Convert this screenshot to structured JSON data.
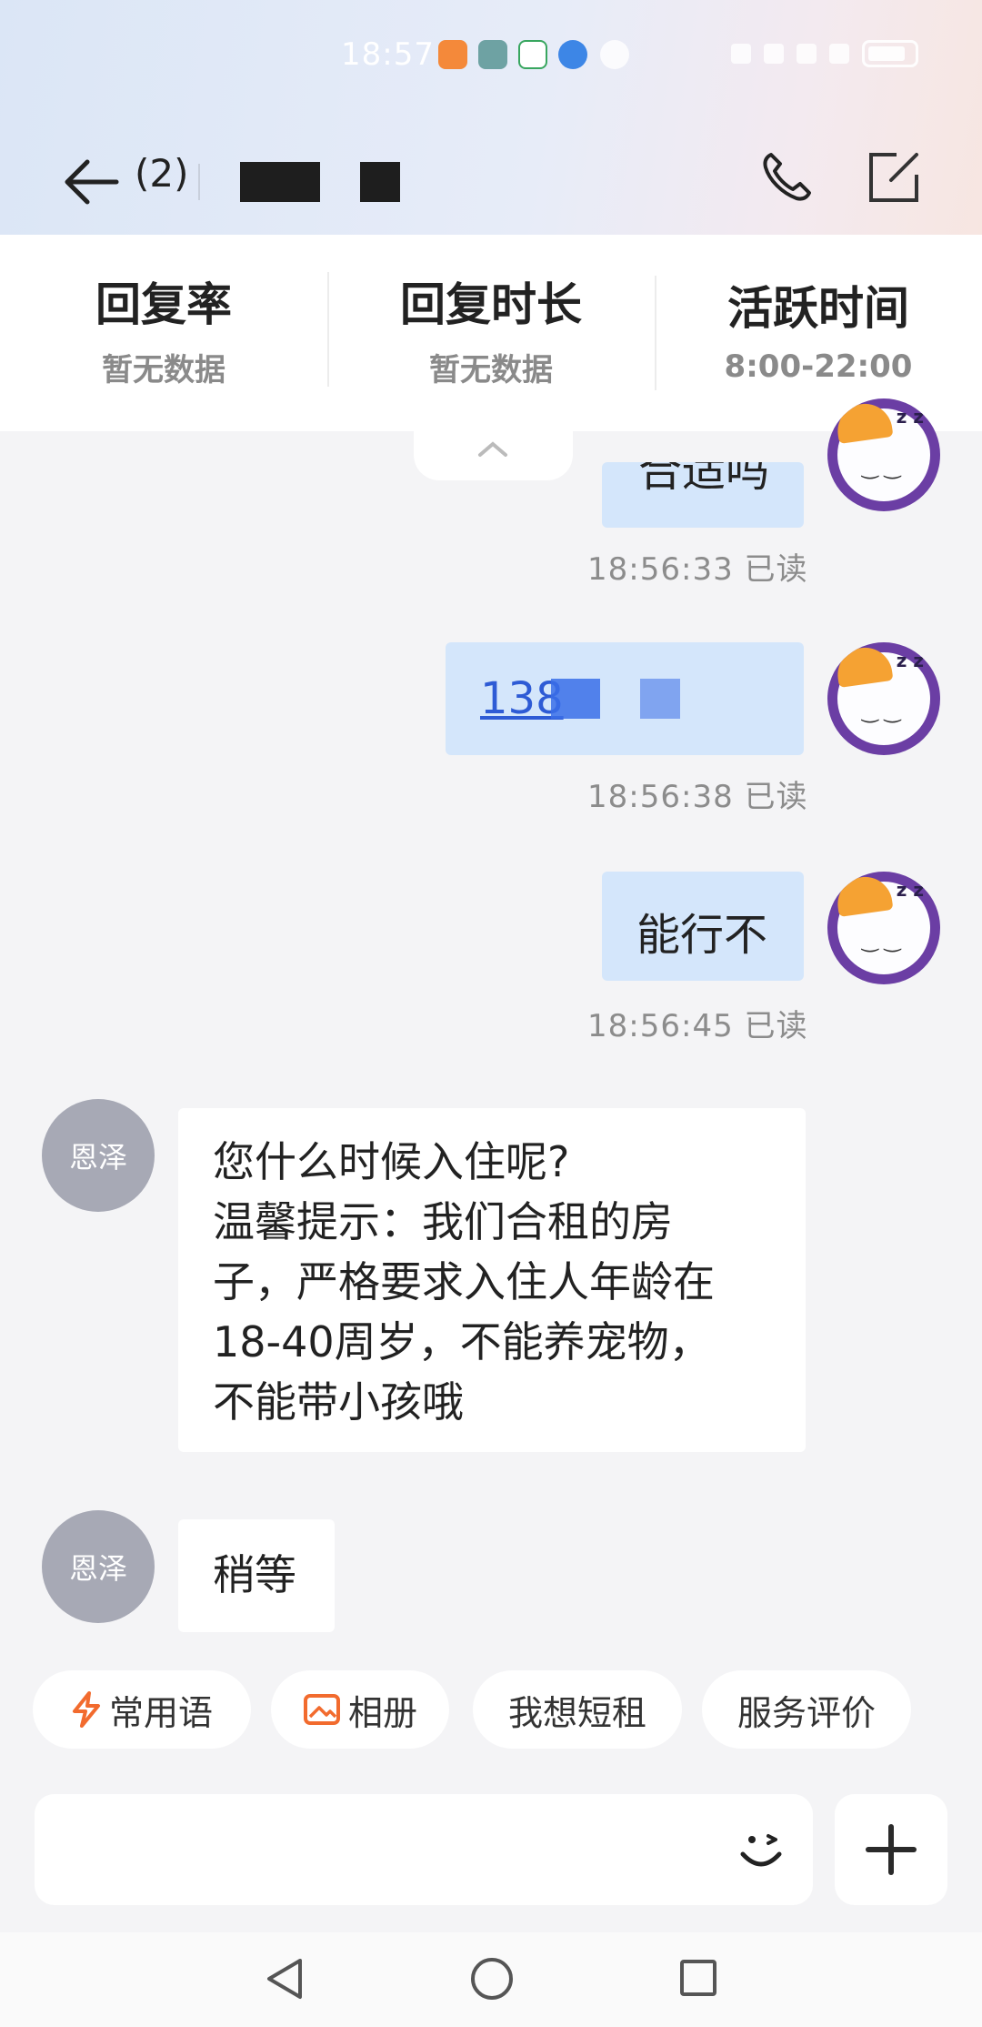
{
  "status_bar": {
    "time": "18:57"
  },
  "header": {
    "back_count": "(2)"
  },
  "stats": [
    {
      "label": "回复率",
      "value": "暂无数据"
    },
    {
      "label": "回复时长",
      "value": "暂无数据"
    },
    {
      "label": "活跃时间",
      "value": "8:00-22:00"
    }
  ],
  "messages": {
    "msg1": {
      "text": "合适吗",
      "time": "18:56:33 已读"
    },
    "msg2": {
      "text": "138",
      "time": "18:56:38 已读"
    },
    "msg3": {
      "text": "能行不",
      "time": "18:56:45 已读"
    },
    "msg4": {
      "sender": "恩泽",
      "lines": [
        "您什么时候入住呢?",
        "温馨提示：我们合租的房",
        "子，严格要求入住人年龄在",
        "18-40周岁，不能养宠物，",
        "不能带小孩哦"
      ]
    },
    "msg5": {
      "sender": "恩泽",
      "text": "稍等"
    }
  },
  "quick_replies": [
    "常用语",
    "相册",
    "我想短租",
    "服务评价"
  ],
  "colors": {
    "accent_orange": "#f26b2e",
    "bubble_out": "#d4e6fb",
    "link": "#2e5bd5",
    "avatar_me_ring": "#6b3ea4"
  }
}
